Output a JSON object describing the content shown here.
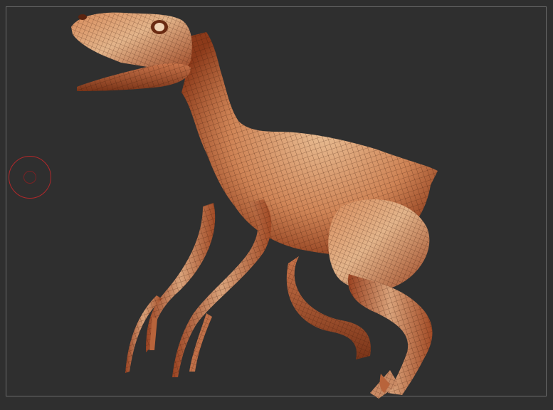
{
  "viewport": {
    "background_color": "#2f2f2f",
    "frame_color": "#6a6a6a"
  },
  "model": {
    "subject": "raptor-dinosaur-sculpt",
    "base_color": "#c9744a",
    "highlight_color": "#e3b48a",
    "shadow_color": "#7a3418",
    "wireframe_color": "#3a1608",
    "display_mode": "polyframe"
  },
  "brush": {
    "icon": "brush-cursor-icon",
    "color": "#b0282a"
  }
}
